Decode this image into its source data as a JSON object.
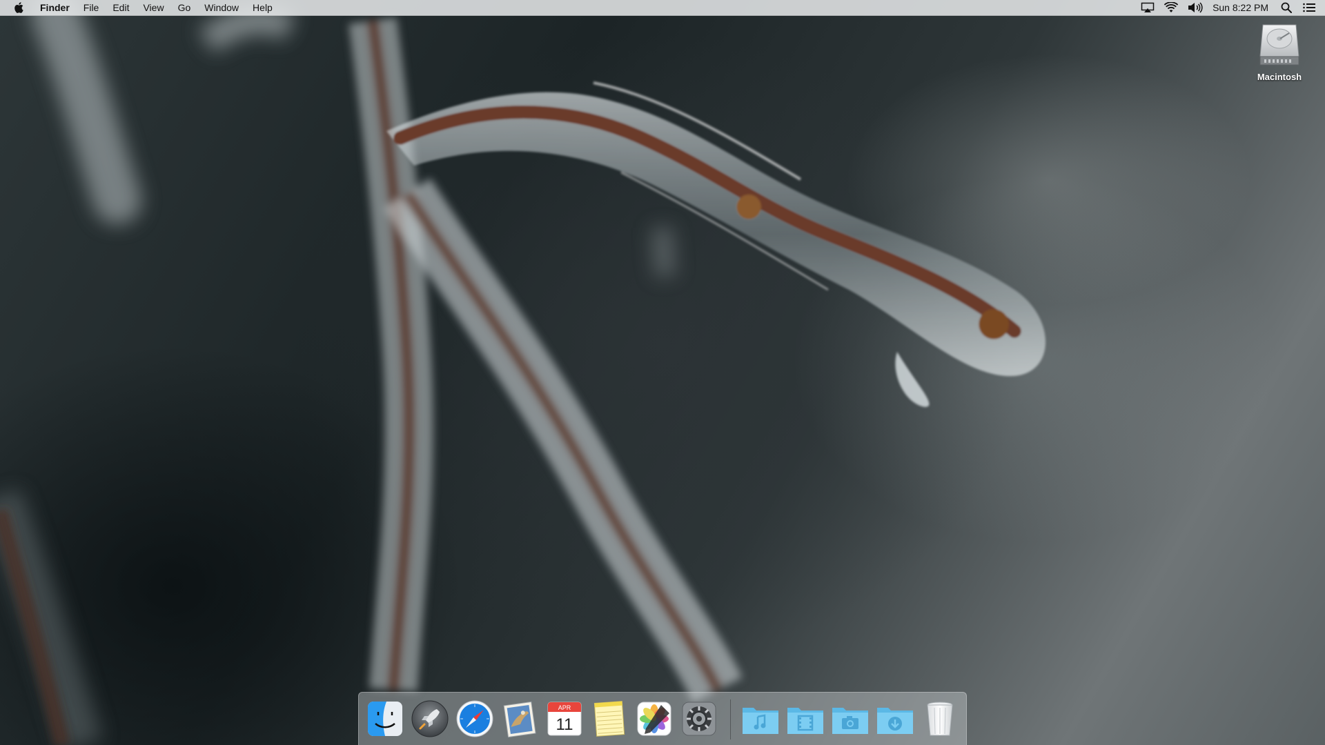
{
  "menubar": {
    "apple_icon": "apple-logo",
    "app_name": "Finder",
    "menus": [
      "File",
      "Edit",
      "View",
      "Go",
      "Window",
      "Help"
    ],
    "status_icons": [
      "airplay-icon",
      "wifi-icon",
      "volume-icon"
    ],
    "clock": "Sun 8:22 PM",
    "right_icons": [
      "spotlight-search-icon",
      "notification-center-icon"
    ]
  },
  "desktop": {
    "drive_label": "Macintosh",
    "drive_icon": "hard-drive-icon"
  },
  "dock": {
    "apps": [
      {
        "name": "Finder",
        "icon": "finder-icon",
        "running": true
      },
      {
        "name": "Launchpad",
        "icon": "launchpad-icon",
        "running": false
      },
      {
        "name": "Safari",
        "icon": "safari-icon",
        "running": true
      },
      {
        "name": "Mail",
        "icon": "mail-icon",
        "running": false
      },
      {
        "name": "Calendar",
        "icon": "calendar-icon",
        "running": false,
        "month": "APR",
        "day": "11"
      },
      {
        "name": "Notes",
        "icon": "notes-icon",
        "running": false
      },
      {
        "name": "Photos",
        "icon": "photos-icon",
        "running": false
      },
      {
        "name": "System Preferences",
        "icon": "gear-icon",
        "running": false
      }
    ],
    "folders": [
      {
        "name": "Music",
        "icon": "music-folder-icon"
      },
      {
        "name": "Movies",
        "icon": "movies-folder-icon"
      },
      {
        "name": "Pictures",
        "icon": "pictures-folder-icon"
      },
      {
        "name": "Downloads",
        "icon": "downloads-folder-icon"
      }
    ],
    "trash": {
      "name": "Trash",
      "icon": "trash-icon"
    }
  },
  "colors": {
    "menubar_bg": "#e8eaeb",
    "folder_blue": "#6cc4ef",
    "safari_blue": "#1a7fe0",
    "calendar_red": "#e8453c"
  }
}
